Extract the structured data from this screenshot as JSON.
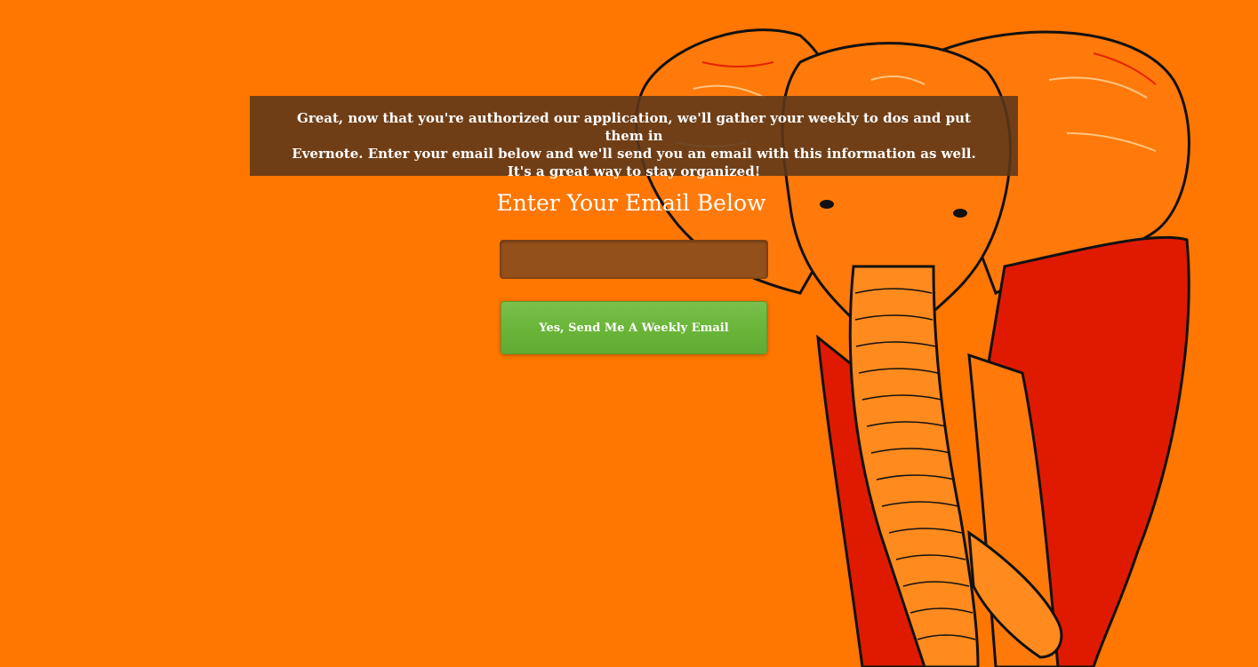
{
  "banner": {
    "line1": "Great, now that you're authorized our application, we'll gather your weekly to dos and put them in",
    "line2": "Evernote. Enter your email below and we'll send you an email with this information as well.",
    "line3": "It's a great way to stay organized!"
  },
  "form": {
    "heading": "Enter Your Email Below",
    "email_value": "",
    "email_placeholder": "",
    "submit_label": "Yes, Send Me A Weekly Email"
  },
  "colors": {
    "background": "#ff7600",
    "banner": "#5c3719",
    "input": "#93501a",
    "button": "#6bb53a"
  },
  "illustration": "elephant-illustration"
}
